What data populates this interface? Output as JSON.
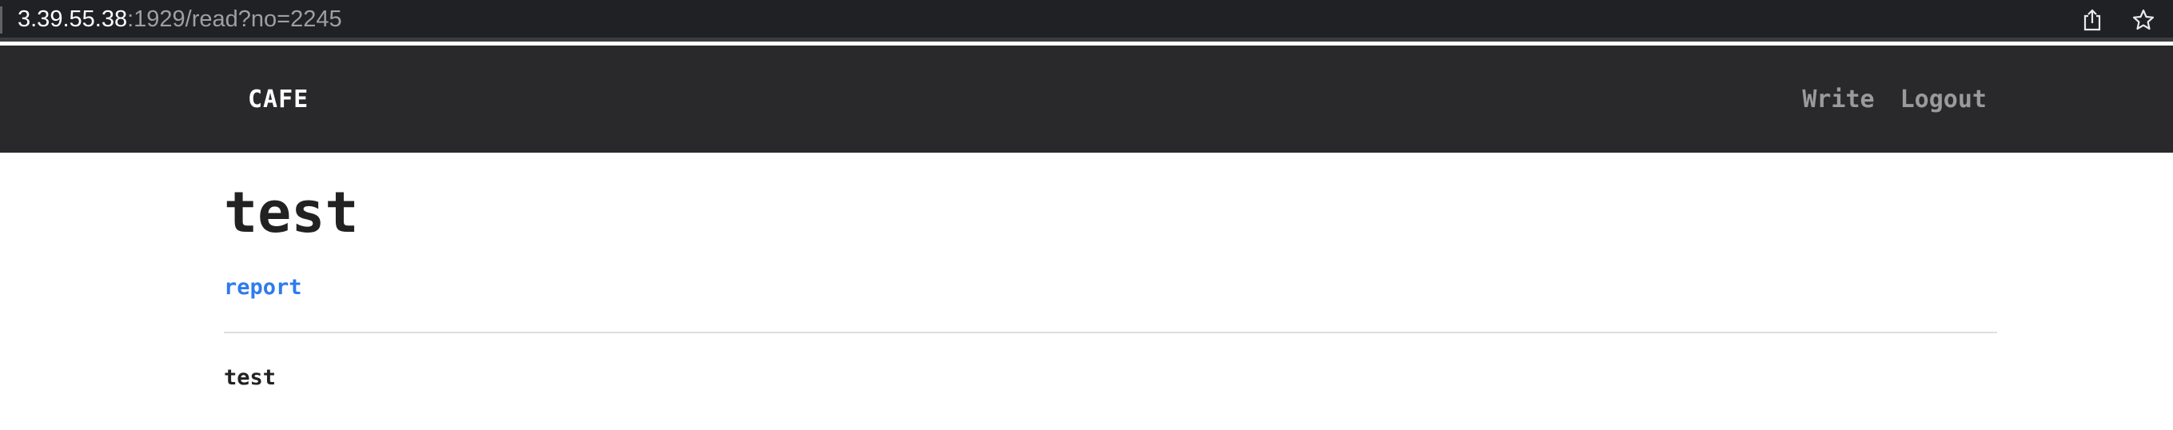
{
  "browser": {
    "url_host": "3.39.55.38",
    "url_path": ":1929/read?no=2245",
    "icons": [
      "share-icon",
      "star-icon"
    ]
  },
  "navbar": {
    "brand": "CAFE",
    "links": [
      {
        "label": "Write"
      },
      {
        "label": "Logout"
      }
    ]
  },
  "post": {
    "title": "test",
    "report_label": "report",
    "body": "test"
  },
  "colors": {
    "browser_bar": "#202124",
    "navbar": "#29282a",
    "link_blue": "#2f7bed",
    "nav_link_gray": "#9a9a9a"
  }
}
